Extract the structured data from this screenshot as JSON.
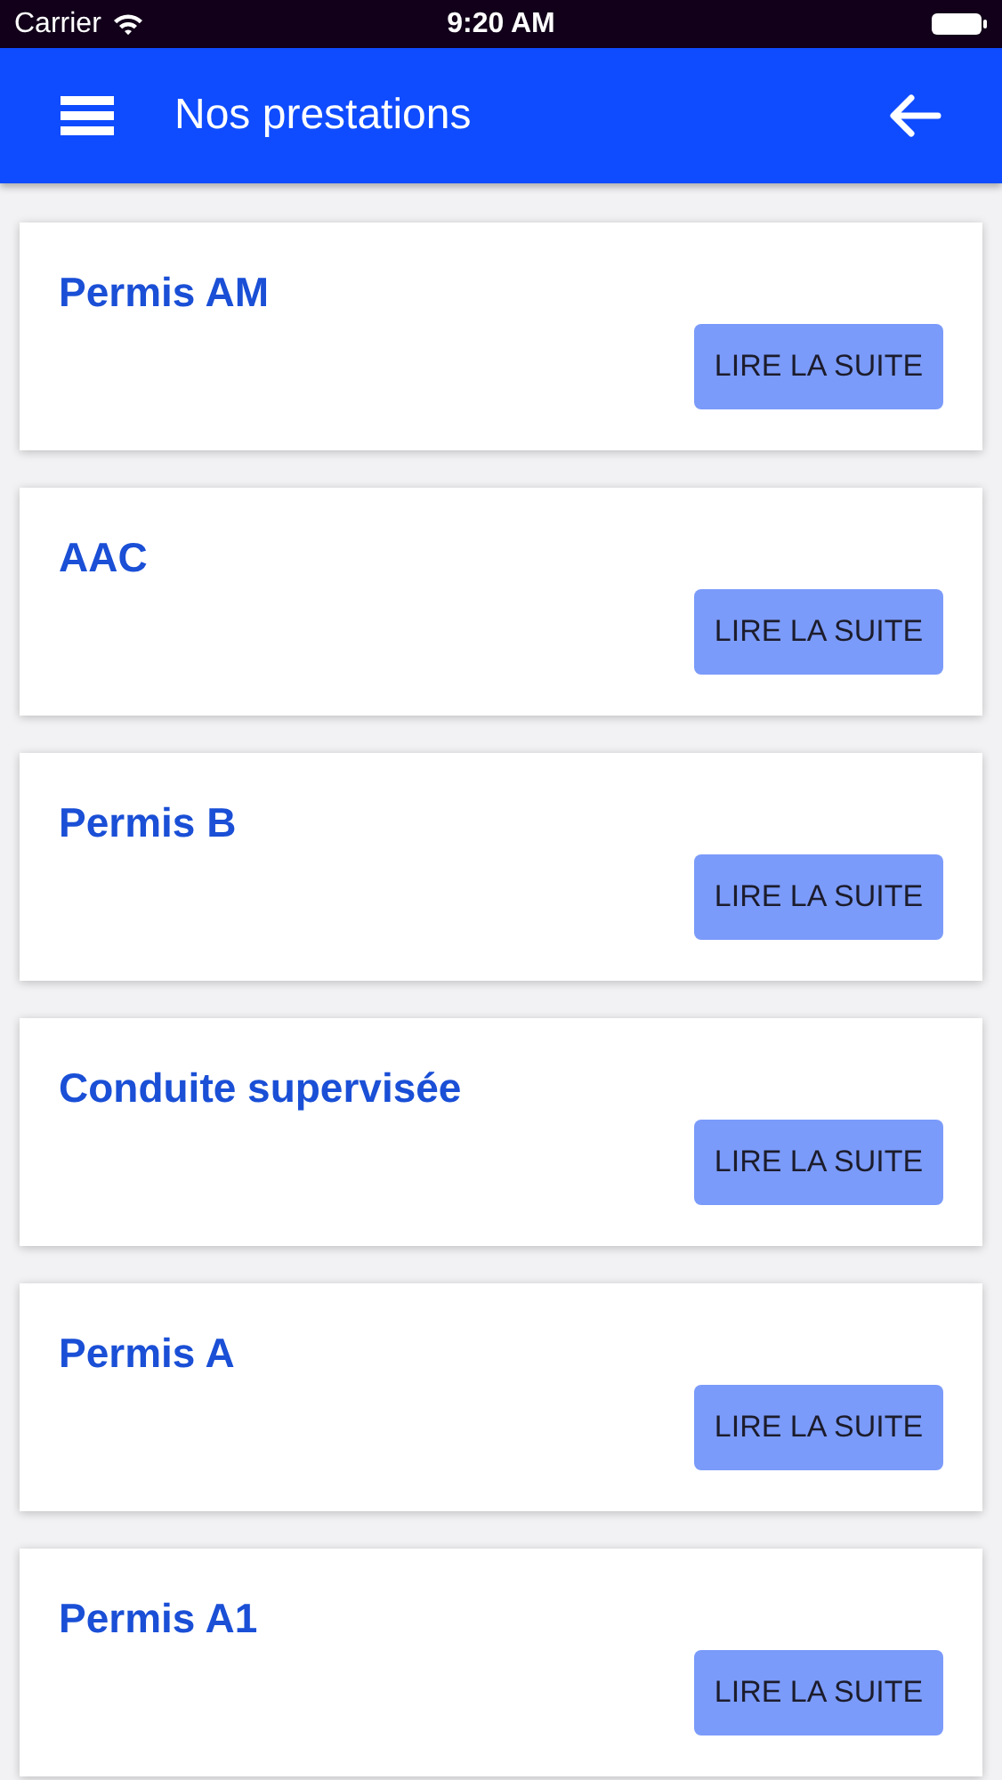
{
  "status_bar": {
    "carrier": "Carrier",
    "time": "9:20 AM"
  },
  "header": {
    "title": "Nos prestations"
  },
  "services": [
    {
      "title": "Permis AM",
      "button": "LIRE LA SUITE"
    },
    {
      "title": "AAC",
      "button": "LIRE LA SUITE"
    },
    {
      "title": "Permis B",
      "button": "LIRE LA SUITE"
    },
    {
      "title": "Conduite supervisée",
      "button": "LIRE LA SUITE"
    },
    {
      "title": "Permis A",
      "button": "LIRE LA SUITE"
    },
    {
      "title": "Permis A1",
      "button": "LIRE LA SUITE"
    }
  ]
}
